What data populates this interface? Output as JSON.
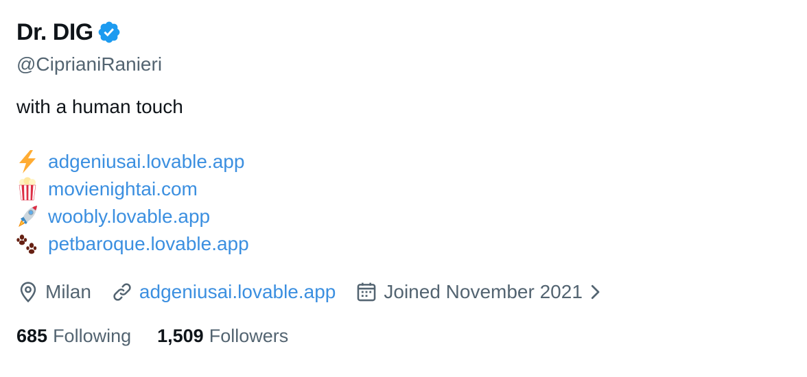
{
  "profile": {
    "display_name": "Dr. DIG",
    "verified_icon": "verified-badge",
    "handle": "@CiprianiRanieri",
    "bio_text": "with a human touch",
    "bio_links": [
      {
        "emoji": "lightning",
        "label": "adgeniusai.lovable.app"
      },
      {
        "emoji": "popcorn",
        "label": "movienightai.com"
      },
      {
        "emoji": "rocket",
        "label": "woobly.lovable.app"
      },
      {
        "emoji": "paw-prints",
        "label": "petbaroque.lovable.app"
      }
    ],
    "location": "Milan",
    "website": "adgeniusai.lovable.app",
    "joined": "Joined November 2021",
    "following_count": "685",
    "following_label": "Following",
    "followers_count": "1,509",
    "followers_label": "Followers"
  },
  "colors": {
    "text": "#0f1419",
    "secondary": "#536471",
    "link": "#3b8fe0",
    "verified": "#1d9bf0"
  }
}
